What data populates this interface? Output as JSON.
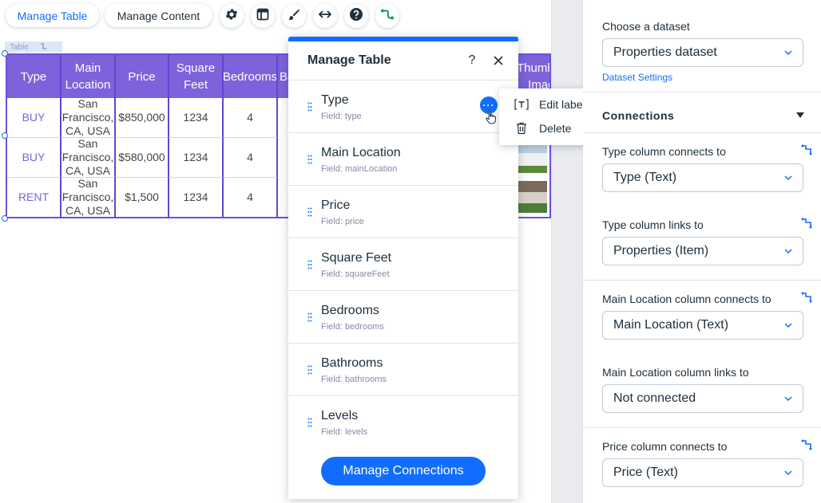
{
  "toolbar": {
    "manage_table": "Manage Table",
    "manage_content": "Manage Content",
    "icons": [
      "gear-icon",
      "layout-icon",
      "brush-icon",
      "stretch-icon",
      "help-icon",
      "connect-data-icon"
    ]
  },
  "table": {
    "tag_label": "Table",
    "headers": [
      "Type",
      "Main Location",
      "Price",
      "Square Feet",
      "Bedrooms",
      "Ba",
      "Thumbnail Image"
    ],
    "rows": [
      {
        "type": "BUY",
        "location": "San Francisco, CA, USA",
        "price": "$850,000",
        "sqft": "1234",
        "bedrooms": "4"
      },
      {
        "type": "BUY",
        "location": "San Francisco, CA, USA",
        "price": "$580,000",
        "sqft": "1234",
        "bedrooms": "4"
      },
      {
        "type": "RENT",
        "location": "San Francisco, CA, USA",
        "price": "$1,500",
        "sqft": "1234",
        "bedrooms": "4"
      }
    ]
  },
  "manage_panel": {
    "title": "Manage Table",
    "help": "?",
    "columns": [
      {
        "label": "Type",
        "field": "Field: type"
      },
      {
        "label": "Main Location",
        "field": "Field: mainLocation"
      },
      {
        "label": "Price",
        "field": "Field: price"
      },
      {
        "label": "Square Feet",
        "field": "Field: squareFeet"
      },
      {
        "label": "Bedrooms",
        "field": "Field: bedrooms"
      },
      {
        "label": "Bathrooms",
        "field": "Field: bathrooms"
      },
      {
        "label": "Levels",
        "field": "Field: levels"
      }
    ],
    "manage_connections": "Manage Connections"
  },
  "context_menu": {
    "edit_label": "Edit label",
    "delete": "Delete"
  },
  "inspector": {
    "choose_dataset_label": "Choose a dataset",
    "dataset_value": "Properties dataset",
    "dataset_settings": "Dataset Settings",
    "connections_title": "Connections",
    "type_connects_label": "Type column connects to",
    "type_connects_value": "Type (Text)",
    "type_links_label": "Type column links to",
    "type_links_value": "Properties (Item)",
    "mainloc_connects_label": "Main Location column connects to",
    "mainloc_connects_value": "Main Location (Text)",
    "mainloc_links_label": "Main Location column links to",
    "mainloc_links_value": "Not connected",
    "price_connects_label": "Price column connects to",
    "price_connects_value": "Price (Text)"
  },
  "colors": {
    "accent": "#116dff",
    "table_header": "#7d62dc",
    "connect_icon": "#1e9e50"
  }
}
